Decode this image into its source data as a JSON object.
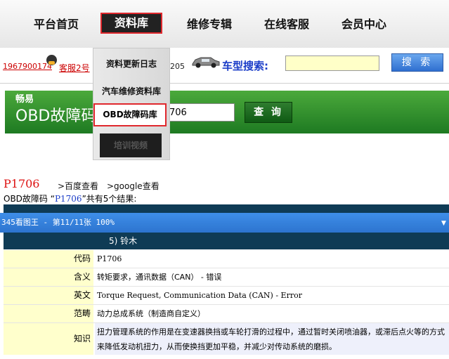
{
  "nav": {
    "items": [
      "平台首页",
      "资料库",
      "维修专辑",
      "在线客服",
      "会员中心"
    ]
  },
  "dropdown": {
    "items": [
      "资料更新日志",
      "汽车维修资料库",
      "OBD故障码库",
      "培训视频"
    ]
  },
  "infobar": {
    "phone": "1967900174",
    "service": "客服2号",
    "number_tail": "205",
    "search_label": "车型搜索:",
    "search_value": "",
    "search_button": "搜 索"
  },
  "banner": {
    "subtitle": "畅易",
    "title": "OBD故障码",
    "input_value": "706",
    "query_button": "查 询"
  },
  "results": {
    "code": "P1706",
    "link_baidu": ">百度查看",
    "link_google": ">google查看",
    "summary_prefix": "OBD故障码 “",
    "summary_code": "P1706",
    "summary_suffix": "”共有5个结果:"
  },
  "viewer": {
    "title": "345看图王 - 第11/11张 100%"
  },
  "detail": {
    "section": "5) 铃木",
    "rows": [
      {
        "label": "代码",
        "value": "P1706"
      },
      {
        "label": "含义",
        "value": "转矩要求，通讯数据（CAN） - 错误"
      },
      {
        "label": "英文",
        "value": "Torque Request, Communication Data (CAN) - Error"
      },
      {
        "label": "范畴",
        "value": "动力总成系统（制造商自定义）"
      },
      {
        "label": "知识",
        "value": "扭力管理系统的作用是在变速器换挡或车轮打滑的过程中，通过暂时关闭喷油器，或滞后点火等的方式来降低发动机扭力，从而使换挡更加平稳，并减少对传动系统的磨损。"
      }
    ]
  },
  "colors": {
    "accent_red": "#e0282d",
    "banner_green": "#2f8f2a",
    "viewer_blue": "#3a86e0",
    "section_navy": "#0f3b55",
    "label_bg": "#ffffcc"
  }
}
